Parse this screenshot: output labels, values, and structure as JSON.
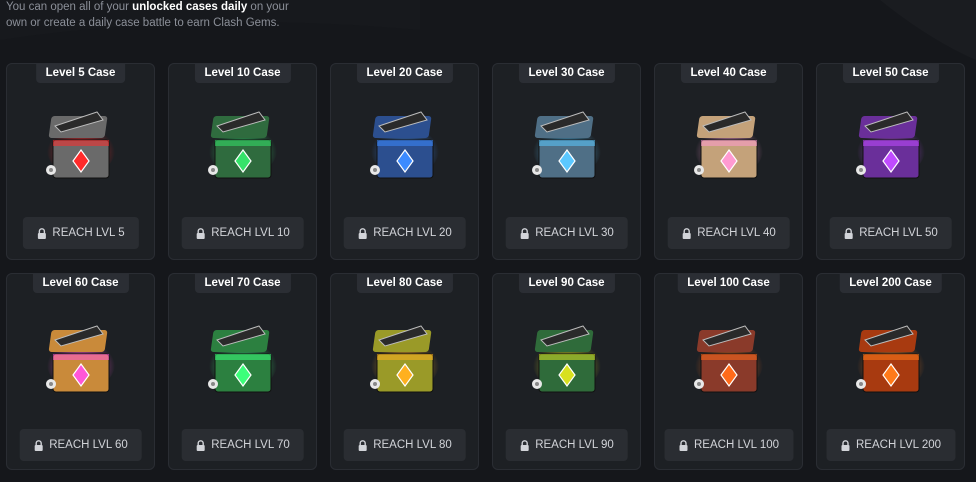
{
  "intro": {
    "before": "You can open all of your ",
    "bold": "unlocked cases daily",
    "after": " on your own or create a daily case battle to earn Clash Gems."
  },
  "cases": [
    {
      "name": "Level 5 Case",
      "button": "REACH LVL 5",
      "theme": "#ff2a2a",
      "box": "#6a6a6a"
    },
    {
      "name": "Level 10 Case",
      "button": "REACH LVL 10",
      "theme": "#35e36a",
      "box": "#2f6b3e"
    },
    {
      "name": "Level 20 Case",
      "button": "REACH LVL 20",
      "theme": "#3d8bff",
      "box": "#2c4f8f"
    },
    {
      "name": "Level 30 Case",
      "button": "REACH LVL 30",
      "theme": "#5bc8ff",
      "box": "#4f6f86"
    },
    {
      "name": "Level 40 Case",
      "button": "REACH LVL 40",
      "theme": "#ff9ad1",
      "box": "#c4a27a"
    },
    {
      "name": "Level 50 Case",
      "button": "REACH LVL 50",
      "theme": "#c04bff",
      "box": "#6a2f9a"
    },
    {
      "name": "Level 60 Case",
      "button": "REACH LVL 60",
      "theme": "#ff56d8",
      "box": "#c98a3a"
    },
    {
      "name": "Level 70 Case",
      "button": "REACH LVL 70",
      "theme": "#3cff7a",
      "box": "#2c8040"
    },
    {
      "name": "Level 80 Case",
      "button": "REACH LVL 80",
      "theme": "#ffb01f",
      "box": "#9a9a28"
    },
    {
      "name": "Level 90 Case",
      "button": "REACH LVL 90",
      "theme": "#d8e01f",
      "box": "#2f6b3a"
    },
    {
      "name": "Level 100 Case",
      "button": "REACH LVL 100",
      "theme": "#ff6a1a",
      "box": "#8a3a2a"
    },
    {
      "name": "Level 200 Case",
      "button": "REACH LVL 200",
      "theme": "#ff7a1a",
      "box": "#a83a10"
    }
  ],
  "icons": {
    "lock": "lock-icon",
    "case": "case-icon"
  }
}
